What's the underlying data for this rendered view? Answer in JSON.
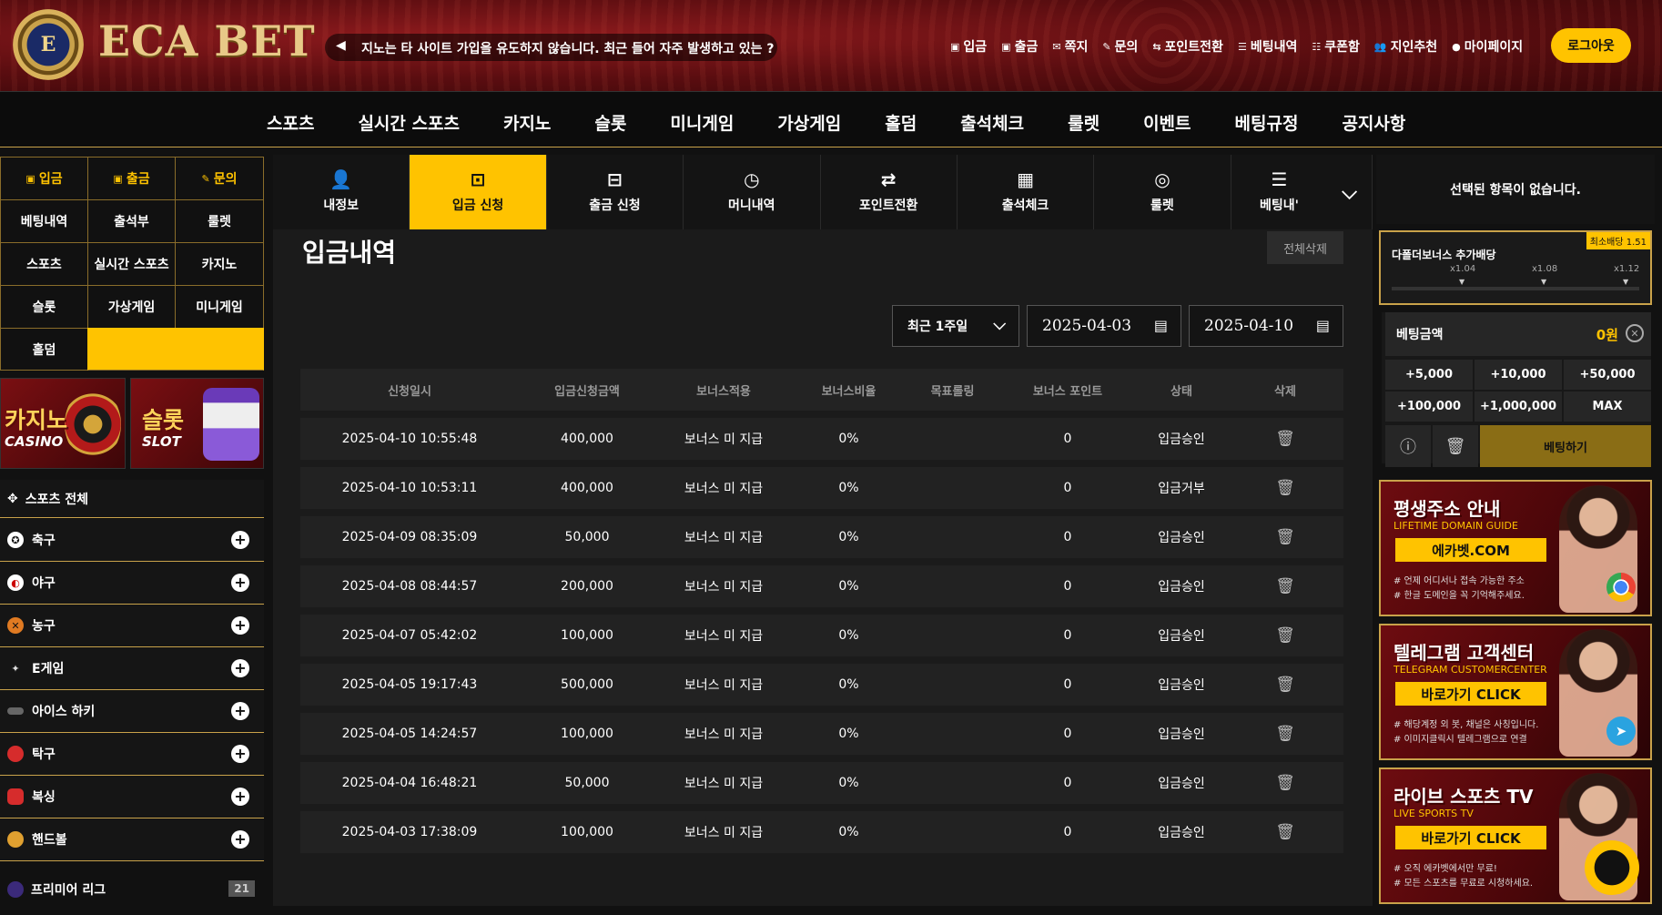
{
  "header": {
    "logo_text": "ECA BET",
    "logo_letter": "E",
    "notice_text": "지노는 타 사이트 가입을 유도하지 않습니다. 최근 들어 자주 발생하고 있는 ?",
    "top_links": [
      "입금",
      "출금",
      "쪽지",
      "문의",
      "포인트전환",
      "베팅내역",
      "쿠폰함",
      "지인추천",
      "마이페이지"
    ],
    "logout_label": "로그아웃"
  },
  "main_nav": [
    "스포츠",
    "실시간 스포츠",
    "카지노",
    "슬롯",
    "미니게임",
    "가상게임",
    "홀덤",
    "출석체크",
    "룰렛",
    "이벤트",
    "베팅규정",
    "공지사항"
  ],
  "left": {
    "grid": [
      [
        "입금",
        "출금",
        "문의"
      ],
      [
        "베팅내역",
        "출석부",
        "룰렛"
      ],
      [
        "스포츠",
        "실시간 스포츠",
        "카지노"
      ],
      [
        "슬롯",
        "가상게임",
        "미니게임"
      ],
      [
        "홀덤"
      ]
    ],
    "banner_casino": {
      "big": "카지노",
      "small": "CASINO"
    },
    "banner_slot": {
      "big": "슬롯",
      "small": "SLOT"
    },
    "sports_all": "스포츠 전체",
    "sports": [
      {
        "label": "축구",
        "icon": "soccer-ball-icon",
        "color": "#ffffff"
      },
      {
        "label": "야구",
        "icon": "baseball-icon",
        "color": "#ffffff"
      },
      {
        "label": "농구",
        "icon": "basketball-icon",
        "color": "#e07a22"
      },
      {
        "label": "E게임",
        "icon": "gamepad-icon",
        "color": "#444444"
      },
      {
        "label": "아이스 하키",
        "icon": "hockey-puck-icon",
        "color": "#666666"
      },
      {
        "label": "탁구",
        "icon": "ping-pong-icon",
        "color": "#d62c2c"
      },
      {
        "label": "복싱",
        "icon": "boxing-glove-icon",
        "color": "#d62c2c"
      },
      {
        "label": "핸드볼",
        "icon": "handball-icon",
        "color": "#e0a030"
      }
    ],
    "premier": {
      "label": "프리미어 리그",
      "count": "21"
    }
  },
  "tabs": [
    {
      "label": "내정보",
      "icon": "user-icon",
      "active": false
    },
    {
      "label": "입금 신청",
      "icon": "deposit-icon",
      "active": true
    },
    {
      "label": "출금 신청",
      "icon": "withdraw-icon",
      "active": false
    },
    {
      "label": "머니내역",
      "icon": "clock-icon",
      "active": false
    },
    {
      "label": "포인트전환",
      "icon": "exchange-icon",
      "active": false
    },
    {
      "label": "출석체크",
      "icon": "calendar-star-icon",
      "active": false
    },
    {
      "label": "룰렛",
      "icon": "roulette-icon",
      "active": false
    },
    {
      "label": "베팅내'",
      "icon": "list-icon",
      "active": false
    }
  ],
  "page": {
    "title": "입금내역",
    "delete_all": "전체삭제",
    "period": "최근 1주일",
    "date_from": "2025-04-03",
    "date_to": "2025-04-10"
  },
  "table": {
    "headers": [
      "신청일시",
      "입금신청금액",
      "보너스적용",
      "보너스비율",
      "목표롤링",
      "보너스 포인트",
      "상태",
      "삭제"
    ],
    "rows": [
      [
        "2025-04-10 10:55:48",
        "400,000",
        "보너스 미 지급",
        "0%",
        "",
        "0",
        "입금승인"
      ],
      [
        "2025-04-10 10:53:11",
        "400,000",
        "보너스 미 지급",
        "0%",
        "",
        "0",
        "입금거부"
      ],
      [
        "2025-04-09 08:35:09",
        "50,000",
        "보너스 미 지급",
        "0%",
        "",
        "0",
        "입금승인"
      ],
      [
        "2025-04-08 08:44:57",
        "200,000",
        "보너스 미 지급",
        "0%",
        "",
        "0",
        "입금승인"
      ],
      [
        "2025-04-07 05:42:02",
        "100,000",
        "보너스 미 지급",
        "0%",
        "",
        "0",
        "입금승인"
      ],
      [
        "2025-04-05 19:17:43",
        "500,000",
        "보너스 미 지급",
        "0%",
        "",
        "0",
        "입금승인"
      ],
      [
        "2025-04-05 14:24:57",
        "100,000",
        "보너스 미 지급",
        "0%",
        "",
        "0",
        "입금승인"
      ],
      [
        "2025-04-04 16:48:21",
        "50,000",
        "보너스 미 지급",
        "0%",
        "",
        "0",
        "입금승인"
      ],
      [
        "2025-04-03 17:38:09",
        "100,000",
        "보너스 미 지급",
        "0%",
        "",
        "0",
        "입금승인"
      ]
    ]
  },
  "right": {
    "no_selection": "선택된 항목이 없습니다.",
    "bonus": {
      "tag": "최소배당 1.51",
      "title": "다폴더보너스 추가배당",
      "multipliers": [
        "x1.04",
        "x1.08",
        "x1.12"
      ]
    },
    "bet_label": "베팅금액",
    "bet_value": "0원",
    "chips": [
      "+5,000",
      "+10,000",
      "+50,000",
      "+100,000",
      "+1,000,000",
      "MAX"
    ],
    "bet_button": "베팅하기",
    "promos": [
      {
        "title": "평생주소 안내",
        "sub": "LIFETIME DOMAIN GUIDE",
        "button": "에카벳.COM",
        "note1": "# 언제 어디서나 접속 가능한 주소",
        "note2": "# 한글 도메인을 꼭 기억해주세요.",
        "badge_color": "#4285f4"
      },
      {
        "title": "텔레그램 고객센터",
        "sub": "TELEGRAM CUSTOMERCENTER",
        "button": "바로가기 CLICK",
        "note1": "# 해당계정 외 봇, 채널은 사칭입니다.",
        "note2": "# 이미지클릭시 텔레그램으로 연결",
        "badge_color": "#2aa3e0"
      },
      {
        "title": "라이브 스포츠 TV",
        "sub": "LIVE SPORTS TV",
        "button": "바로가기 CLICK",
        "note1": "# 오직 에카벳에서만 무료!",
        "note2": "# 모든 스포츠를 무료로 시청하세요.",
        "badge_color": "#ffc300"
      }
    ]
  },
  "colors": {
    "accent": "#ffc300",
    "gold_border": "#c9a24a",
    "header_red": "#7a0f12"
  }
}
